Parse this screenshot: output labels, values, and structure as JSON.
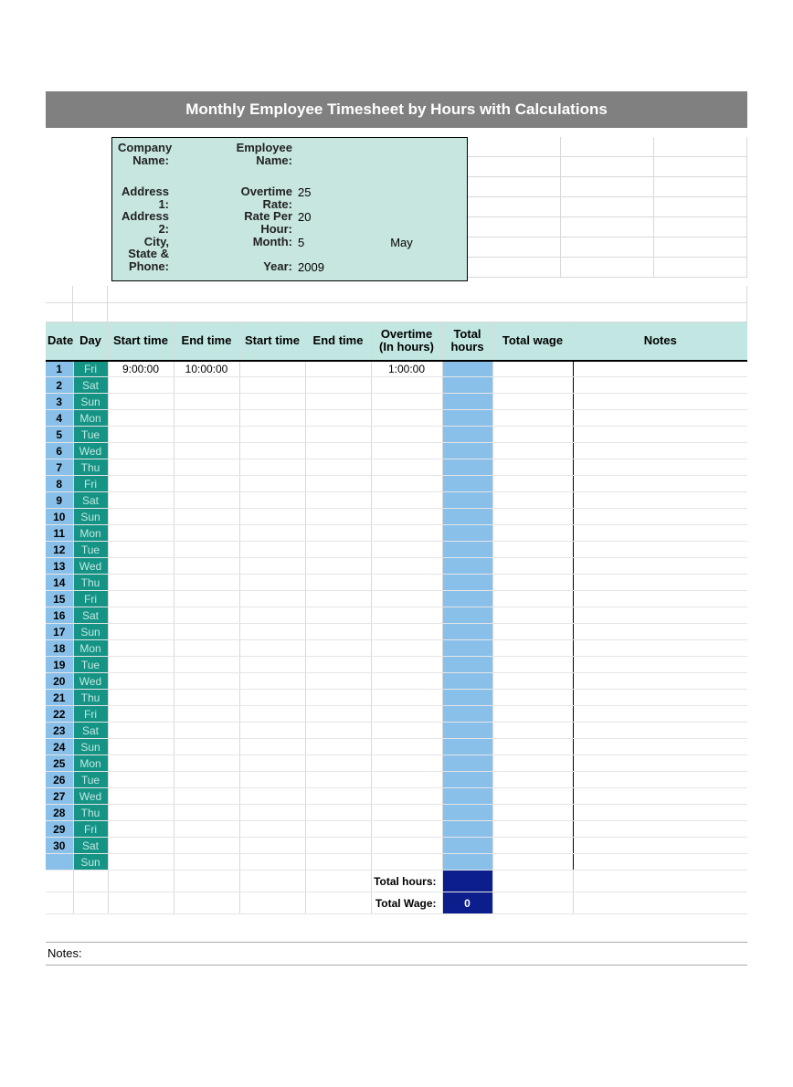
{
  "title": "Monthly Employee Timesheet by Hours with Calculations",
  "info": {
    "labels": {
      "company": "Company Name:",
      "addr1": "Address 1:",
      "addr2": "Address 2:",
      "city": "City, State &",
      "phone": "Phone:",
      "employee": "Employee Name:",
      "ot_rate": "Overtime Rate:",
      "rate": "Rate Per Hour:",
      "month": "Month:",
      "year": "Year:"
    },
    "values": {
      "company": "",
      "addr1": "",
      "addr2": "",
      "city": "",
      "phone": "",
      "employee": "",
      "ot_rate": "25",
      "rate": "20",
      "month_num": "5",
      "month_name": "May",
      "year": "2009"
    }
  },
  "columns": {
    "date": "Date",
    "day": "Day",
    "start1": "Start time",
    "end1": "End time",
    "start2": "Start time",
    "end2": "End time",
    "overtime": "Overtime (In hours)",
    "thours": "Total hours",
    "twage": "Total wage",
    "notes": "Notes"
  },
  "rows": [
    {
      "date": "1",
      "day": "Fri",
      "start1": "9:00:00",
      "end1": "10:00:00",
      "start2": "",
      "end2": "",
      "ot": "1:00:00",
      "th": "",
      "tw": "",
      "n": ""
    },
    {
      "date": "2",
      "day": "Sat",
      "start1": "",
      "end1": "",
      "start2": "",
      "end2": "",
      "ot": "",
      "th": "",
      "tw": "",
      "n": ""
    },
    {
      "date": "3",
      "day": "Sun",
      "start1": "",
      "end1": "",
      "start2": "",
      "end2": "",
      "ot": "",
      "th": "",
      "tw": "",
      "n": ""
    },
    {
      "date": "4",
      "day": "Mon",
      "start1": "",
      "end1": "",
      "start2": "",
      "end2": "",
      "ot": "",
      "th": "",
      "tw": "",
      "n": ""
    },
    {
      "date": "5",
      "day": "Tue",
      "start1": "",
      "end1": "",
      "start2": "",
      "end2": "",
      "ot": "",
      "th": "",
      "tw": "",
      "n": ""
    },
    {
      "date": "6",
      "day": "Wed",
      "start1": "",
      "end1": "",
      "start2": "",
      "end2": "",
      "ot": "",
      "th": "",
      "tw": "",
      "n": ""
    },
    {
      "date": "7",
      "day": "Thu",
      "start1": "",
      "end1": "",
      "start2": "",
      "end2": "",
      "ot": "",
      "th": "",
      "tw": "",
      "n": ""
    },
    {
      "date": "8",
      "day": "Fri",
      "start1": "",
      "end1": "",
      "start2": "",
      "end2": "",
      "ot": "",
      "th": "",
      "tw": "",
      "n": ""
    },
    {
      "date": "9",
      "day": "Sat",
      "start1": "",
      "end1": "",
      "start2": "",
      "end2": "",
      "ot": "",
      "th": "",
      "tw": "",
      "n": ""
    },
    {
      "date": "10",
      "day": "Sun",
      "start1": "",
      "end1": "",
      "start2": "",
      "end2": "",
      "ot": "",
      "th": "",
      "tw": "",
      "n": ""
    },
    {
      "date": "11",
      "day": "Mon",
      "start1": "",
      "end1": "",
      "start2": "",
      "end2": "",
      "ot": "",
      "th": "",
      "tw": "",
      "n": ""
    },
    {
      "date": "12",
      "day": "Tue",
      "start1": "",
      "end1": "",
      "start2": "",
      "end2": "",
      "ot": "",
      "th": "",
      "tw": "",
      "n": ""
    },
    {
      "date": "13",
      "day": "Wed",
      "start1": "",
      "end1": "",
      "start2": "",
      "end2": "",
      "ot": "",
      "th": "",
      "tw": "",
      "n": ""
    },
    {
      "date": "14",
      "day": "Thu",
      "start1": "",
      "end1": "",
      "start2": "",
      "end2": "",
      "ot": "",
      "th": "",
      "tw": "",
      "n": ""
    },
    {
      "date": "15",
      "day": "Fri",
      "start1": "",
      "end1": "",
      "start2": "",
      "end2": "",
      "ot": "",
      "th": "",
      "tw": "",
      "n": ""
    },
    {
      "date": "16",
      "day": "Sat",
      "start1": "",
      "end1": "",
      "start2": "",
      "end2": "",
      "ot": "",
      "th": "",
      "tw": "",
      "n": ""
    },
    {
      "date": "17",
      "day": "Sun",
      "start1": "",
      "end1": "",
      "start2": "",
      "end2": "",
      "ot": "",
      "th": "",
      "tw": "",
      "n": ""
    },
    {
      "date": "18",
      "day": "Mon",
      "start1": "",
      "end1": "",
      "start2": "",
      "end2": "",
      "ot": "",
      "th": "",
      "tw": "",
      "n": ""
    },
    {
      "date": "19",
      "day": "Tue",
      "start1": "",
      "end1": "",
      "start2": "",
      "end2": "",
      "ot": "",
      "th": "",
      "tw": "",
      "n": ""
    },
    {
      "date": "20",
      "day": "Wed",
      "start1": "",
      "end1": "",
      "start2": "",
      "end2": "",
      "ot": "",
      "th": "",
      "tw": "",
      "n": ""
    },
    {
      "date": "21",
      "day": "Thu",
      "start1": "",
      "end1": "",
      "start2": "",
      "end2": "",
      "ot": "",
      "th": "",
      "tw": "",
      "n": ""
    },
    {
      "date": "22",
      "day": "Fri",
      "start1": "",
      "end1": "",
      "start2": "",
      "end2": "",
      "ot": "",
      "th": "",
      "tw": "",
      "n": ""
    },
    {
      "date": "23",
      "day": "Sat",
      "start1": "",
      "end1": "",
      "start2": "",
      "end2": "",
      "ot": "",
      "th": "",
      "tw": "",
      "n": ""
    },
    {
      "date": "24",
      "day": "Sun",
      "start1": "",
      "end1": "",
      "start2": "",
      "end2": "",
      "ot": "",
      "th": "",
      "tw": "",
      "n": ""
    },
    {
      "date": "25",
      "day": "Mon",
      "start1": "",
      "end1": "",
      "start2": "",
      "end2": "",
      "ot": "",
      "th": "",
      "tw": "",
      "n": ""
    },
    {
      "date": "26",
      "day": "Tue",
      "start1": "",
      "end1": "",
      "start2": "",
      "end2": "",
      "ot": "",
      "th": "",
      "tw": "",
      "n": ""
    },
    {
      "date": "27",
      "day": "Wed",
      "start1": "",
      "end1": "",
      "start2": "",
      "end2": "",
      "ot": "",
      "th": "",
      "tw": "",
      "n": ""
    },
    {
      "date": "28",
      "day": "Thu",
      "start1": "",
      "end1": "",
      "start2": "",
      "end2": "",
      "ot": "",
      "th": "",
      "tw": "",
      "n": ""
    },
    {
      "date": "29",
      "day": "Fri",
      "start1": "",
      "end1": "",
      "start2": "",
      "end2": "",
      "ot": "",
      "th": "",
      "tw": "",
      "n": ""
    },
    {
      "date": "30",
      "day": "Sat",
      "start1": "",
      "end1": "",
      "start2": "",
      "end2": "",
      "ot": "",
      "th": "",
      "tw": "",
      "n": ""
    },
    {
      "date": "",
      "day": "Sun",
      "start1": "",
      "end1": "",
      "start2": "",
      "end2": "",
      "ot": "",
      "th": "",
      "tw": "",
      "n": ""
    }
  ],
  "summary": {
    "total_hours_label": "Total hours:",
    "total_hours_value": "",
    "total_wage_label": "Total Wage:",
    "total_wage_value": "0"
  },
  "notes_label": "Notes:"
}
